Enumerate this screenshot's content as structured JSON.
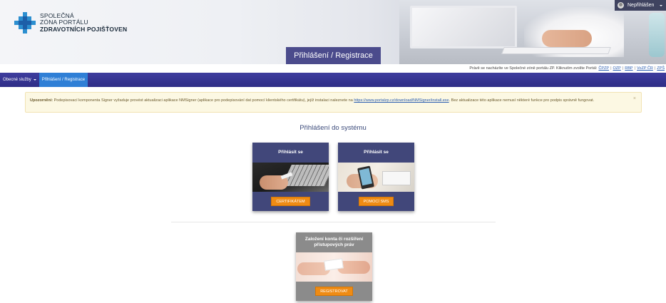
{
  "header": {
    "logo_line1": "SPOLEČNÁ",
    "logo_line2": "ZÓNA PORTÁLU",
    "logo_line3": "ZDRAVOTNÍCH POJIŠŤOVEN",
    "hero_tab": "Přihlášení / Registrace",
    "user_label": "Nepřihlášen"
  },
  "portal_strip": {
    "text": "Právě se nacházíte ve Společné zóně portálu ZP. Kliknutím zvolíte Portál:",
    "links": [
      "ČPZP",
      "OZP",
      "RBP",
      "VoZP ČR",
      "ZPŠ"
    ]
  },
  "navbar": {
    "items": [
      {
        "label": "Obecné služby",
        "has_caret": true
      },
      {
        "label": "Přihlášení / Registrace",
        "active": true
      }
    ]
  },
  "alert": {
    "title": "Upozornění:",
    "text_before": "Podepisovací komponenta Signer vyžaduje provést aktualizaci aplikace NMSigner (aplikace pro podepisování dat pomocí klientského certifikátu), jejíž instalaci naleznete na",
    "link": "https://www.portalzp.cz/download/NMSigner/install.exe",
    "text_after": ". Bez aktualizace této aplikace nemusí některé funkce pro podpis správně fungovat.",
    "close": "×"
  },
  "main": {
    "title": "Přihlášení do systému",
    "cards": [
      {
        "title": "Přihlásit se",
        "button": "CERTIFIKÁTEM"
      },
      {
        "title": "Přihlásit se",
        "button": "POMOCÍ SMS"
      },
      {
        "title": "Založení konta či rozšíření přístupových práv",
        "button": "REGISTROVAT"
      }
    ]
  },
  "colors": {
    "navbar": "#2e2d86",
    "nav_active": "#2f7fd6",
    "card_head": "#41477a",
    "card_button": "#ef8b14",
    "alert_bg": "#fcf8e3"
  }
}
